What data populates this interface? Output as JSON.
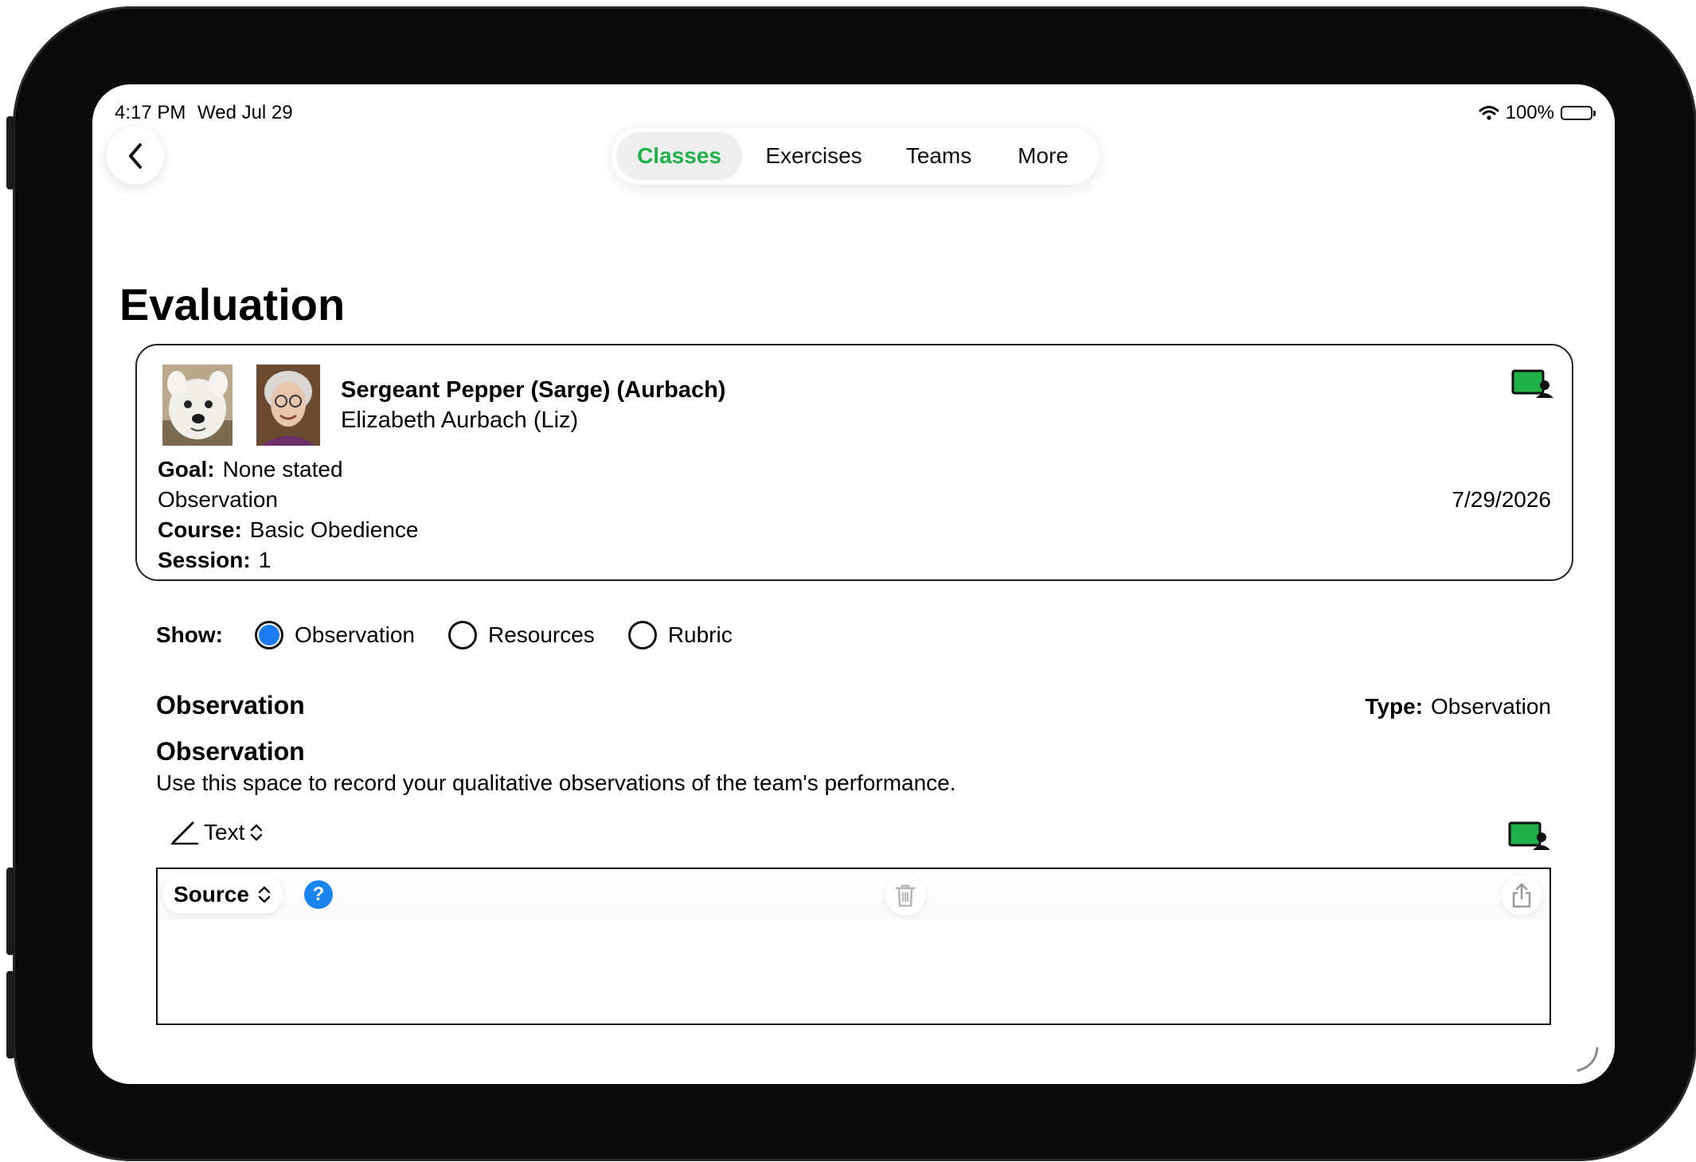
{
  "status_bar": {
    "time": "4:17 PM",
    "date": "Wed Jul 29",
    "battery": "100%"
  },
  "nav": {
    "tabs": [
      {
        "label": "Classes",
        "active": true
      },
      {
        "label": "Exercises",
        "active": false
      },
      {
        "label": "Teams",
        "active": false
      },
      {
        "label": "More",
        "active": false
      }
    ]
  },
  "page": {
    "title": "Evaluation"
  },
  "team_card": {
    "team_name": "Sergeant Pepper (Sarge) (Aurbach)",
    "handler_name": "Elizabeth Aurbach  (Liz)",
    "goal_label": "Goal:",
    "goal_value": "None stated",
    "eval_type": "Observation",
    "course_label": "Course:",
    "course_value": "Basic Obedience",
    "session_label": "Session:",
    "session_value": "1",
    "date": "7/29/2026"
  },
  "show": {
    "label": "Show:",
    "options": [
      {
        "label": "Observation",
        "selected": true
      },
      {
        "label": "Resources",
        "selected": false
      },
      {
        "label": "Rubric",
        "selected": false
      }
    ]
  },
  "observation": {
    "section_title": "Observation",
    "type_label": "Type:",
    "type_value": "Observation",
    "item_title": "Observation",
    "description": "Use this space to record your qualitative observations of the team's performance.",
    "mode_label": "Text",
    "editor": {
      "source_label": "Source",
      "help_label": "?",
      "content": ""
    }
  },
  "colors": {
    "accent_green": "#1fb04a",
    "radio_blue": "#1a7cf0",
    "help_blue": "#1a84f0"
  },
  "icons": [
    "chevron-left-icon",
    "wifi-icon",
    "battery-icon",
    "whiteboard-person-icon",
    "pencil-icon",
    "up-down-chevron-icon",
    "help-icon",
    "trash-icon",
    "share-icon"
  ]
}
